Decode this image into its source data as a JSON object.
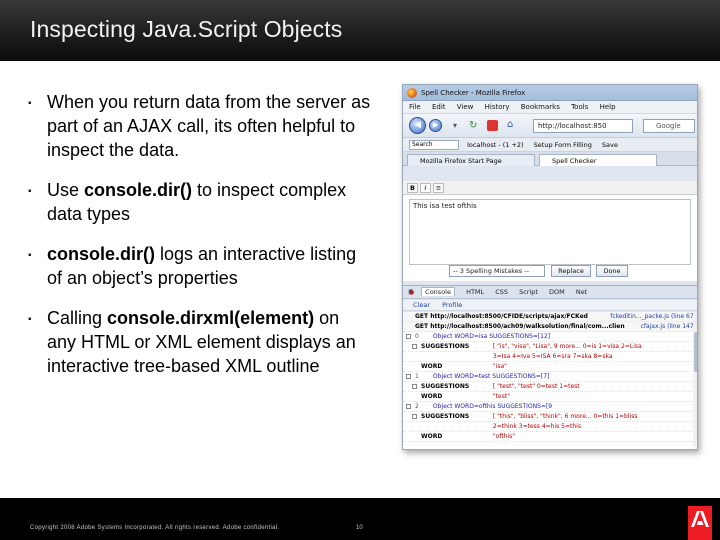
{
  "slide": {
    "title": "Inspecting Java.Script Objects"
  },
  "bullets": [
    {
      "pre": "When you return data from the server as part of an AJAX call, its often helpful to inspect the data.",
      "bold": "",
      "post": ""
    },
    {
      "pre": "Use ",
      "bold": "console.dir()",
      "post": " to inspect complex data types"
    },
    {
      "pre": "",
      "bold": "console.dir()",
      "post": " logs an interactive listing of an object’s properties"
    },
    {
      "pre": "Calling ",
      "bold": "console.dirxml(element)",
      "post": " on any HTML or XML element displays an interactive tree-based XML outline"
    }
  ],
  "bullet_marker": "▪",
  "screenshot": {
    "window_title": "Spell Checker - Mozilla Firefox",
    "menu": [
      "File",
      "Edit",
      "View",
      "History",
      "Bookmarks",
      "Tools",
      "Help"
    ],
    "url": "http://localhost:850",
    "search_placeholder": "Google",
    "toolbar": {
      "search_label": "Search",
      "localhost_label": "localhost - (1 +2)",
      "setup_form_filling": "Setup Form Filling",
      "save_label": "Save"
    },
    "tabs": [
      "Mozilla Firefox Start Page",
      "Spell Checker"
    ],
    "editor_text": "This isa test ofthis",
    "spell_select": "-- 3 Spelling Mistakes --",
    "replace_button": "Replace",
    "done_button": "Done",
    "firebug_tabs": [
      "Console",
      "HTML",
      "CSS",
      "Script",
      "DOM",
      "Net"
    ],
    "firebug_sub": [
      "Clear",
      "Profile"
    ],
    "console_lines": [
      {
        "kind": "get",
        "text": "GET http://localhost:8500/CFIDE/scripts/ajax/FCKed",
        "right": "fckeditin..._packe.js (line 67)"
      },
      {
        "kind": "get",
        "text": "GET http://localhost:8500/ach09/walksolution/final/com...clien",
        "right": "cfajax.js (line 147)"
      },
      {
        "kind": "row",
        "idx": "0",
        "key": "",
        "val": "Object WORD=isa SUGGESTIONS=[12]"
      },
      {
        "kind": "tree",
        "key": "SUGGESTIONS",
        "val": "[ \"is\", \"visa\", \"Lisa\", 9 more... 0=is 1=visa 2=Lisa"
      },
      {
        "kind": "tree",
        "key": "",
        "val": "3=Isa 4=Iva 5=ISA 6=sra 7=ska 8=ska"
      },
      {
        "kind": "tree",
        "key": "WORD",
        "val": "\"isa\""
      },
      {
        "kind": "row",
        "idx": "1",
        "key": "",
        "val": "Object WORD=test SUGGESTIONS=[7]"
      },
      {
        "kind": "tree",
        "key": "SUGGESTIONS",
        "val": "[ \"test\", \"test\" 0=test 1=test"
      },
      {
        "kind": "tree",
        "key": "WORD",
        "val": "\"test\""
      },
      {
        "kind": "row",
        "idx": "2",
        "key": "",
        "val": "Object WORD=ofthis SUGGESTIONS=[9"
      },
      {
        "kind": "tree",
        "key": "SUGGESTIONS",
        "val": "[ \"this\", \"bliss\", \"think\", 6 more... 0=this 1=bliss"
      },
      {
        "kind": "tree",
        "key": "",
        "val": "2=think 3=tess 4=his 5=this"
      },
      {
        "kind": "tree",
        "key": "WORD",
        "val": "\"ofthis\""
      }
    ]
  },
  "footer": {
    "copyright": "Copyright 2008 Adobe Systems Incorporated.  All rights reserved.  Adobe confidential.",
    "page_number": "10"
  },
  "colors": {
    "title_bar": "#1c1c1c",
    "footer": "#000000",
    "adobe_red": "#ed1c24"
  }
}
